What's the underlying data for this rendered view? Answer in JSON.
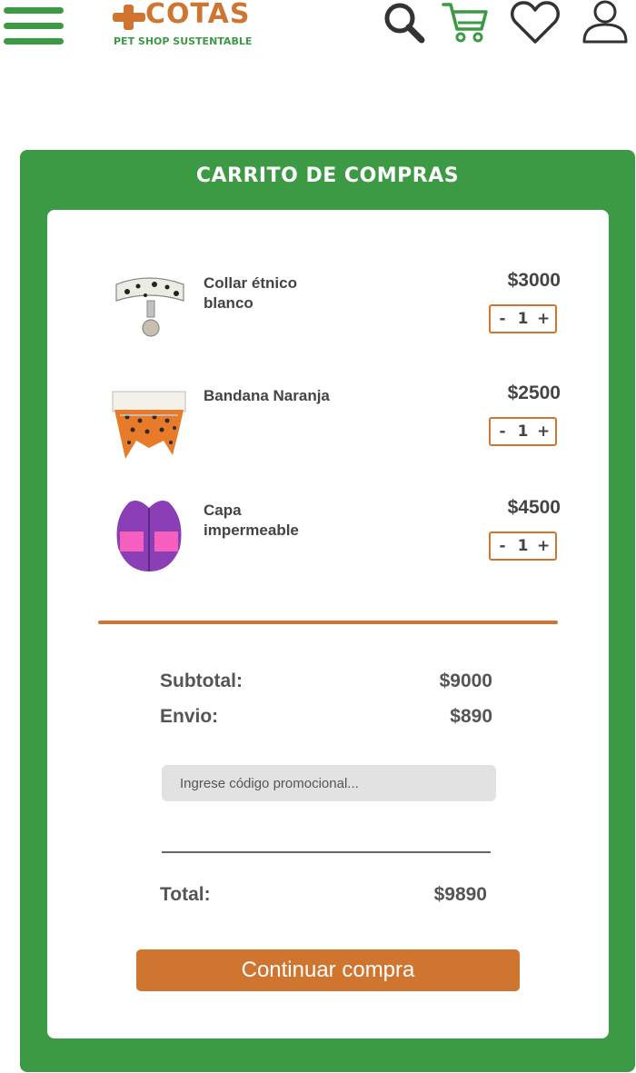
{
  "header": {
    "brand": "COTAS",
    "tagline": "PET SHOP SUSTENTABLE",
    "icons": [
      "menu-icon",
      "search-icon",
      "cart-icon",
      "heart-icon",
      "user-icon"
    ]
  },
  "cart": {
    "title": "CARRITO DE COMPRAS",
    "items": [
      {
        "name": "Collar étnico blanco",
        "price": "$3000",
        "qty": "1"
      },
      {
        "name": "Bandana Naranja",
        "price": "$2500",
        "qty": "1"
      },
      {
        "name": "Capa impermeable",
        "price": "$4500",
        "qty": "1"
      }
    ],
    "qty_minus": "-",
    "qty_plus": "+"
  },
  "summary": {
    "subtotal_label": "Subtotal:",
    "subtotal_value": "$9000",
    "shipping_label": "Envio:",
    "shipping_value": "$890",
    "promo_placeholder": "Ingrese código promocional...",
    "total_label": "Total:",
    "total_value": "$9890",
    "continue_label": "Continuar compra"
  },
  "colors": {
    "green": "#3c9a44",
    "orange": "#d07530",
    "input_bg": "#e2e2e2"
  }
}
